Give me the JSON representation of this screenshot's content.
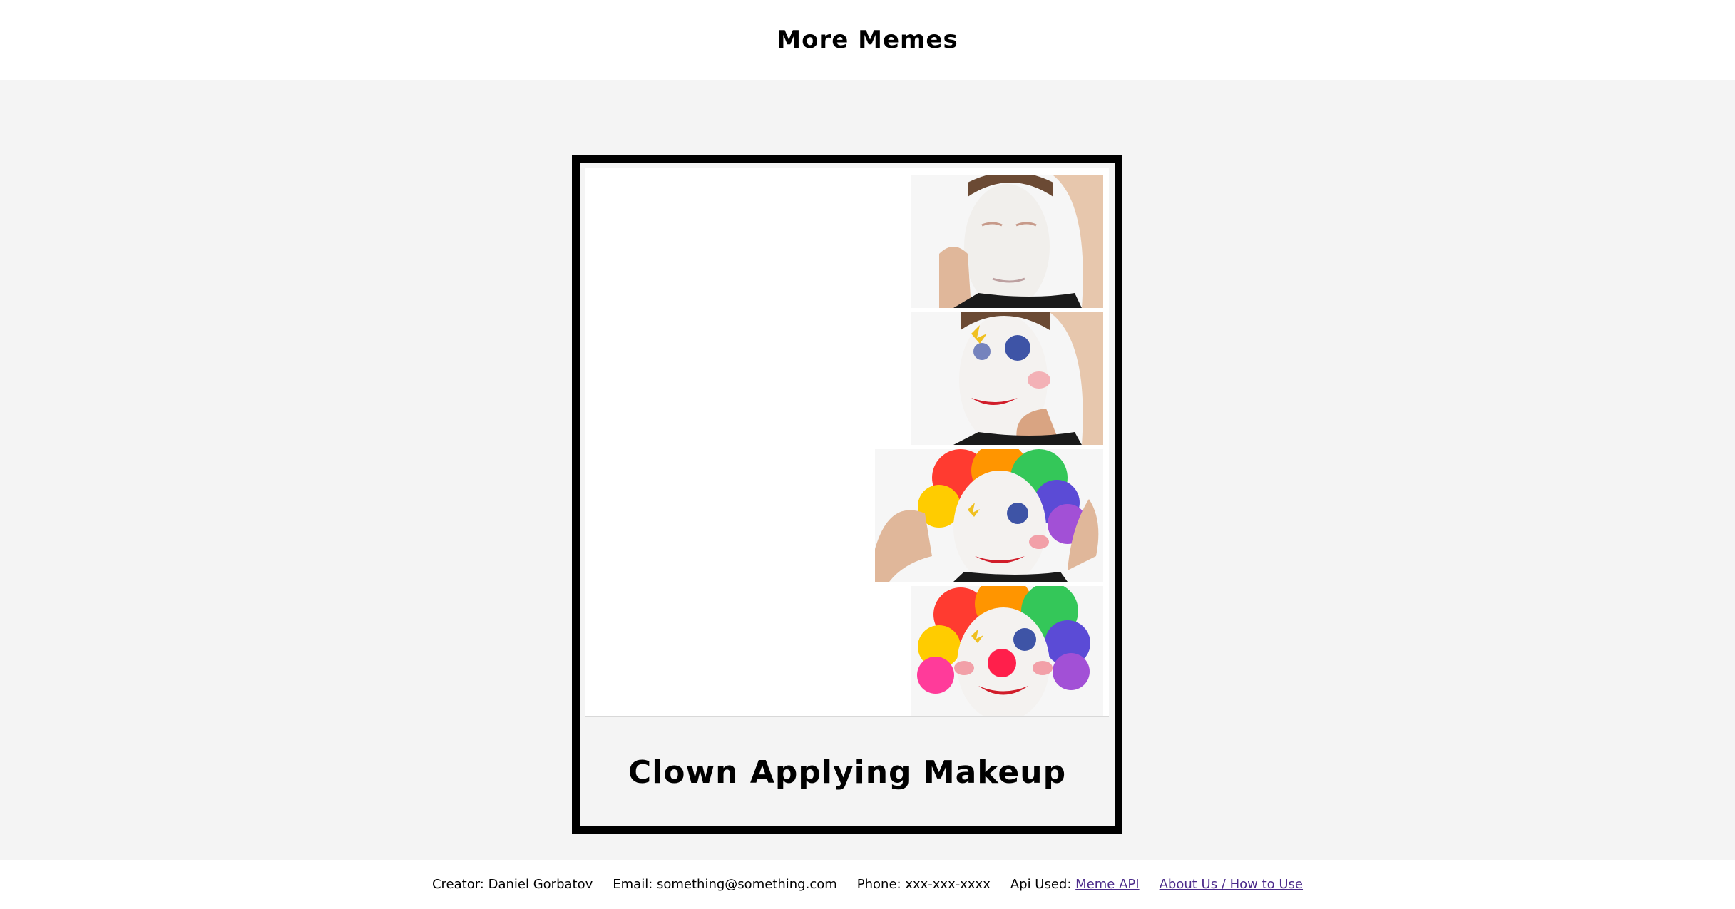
{
  "header": {
    "title": "More Memes"
  },
  "meme": {
    "name": "Clown Applying Makeup",
    "image_description_icon": "clown-makeup-meme-image"
  },
  "footer": {
    "creator_label": "Creator:",
    "creator_value": "Daniel Gorbatov",
    "email_label": "Email:",
    "email_value": "something@something.com",
    "phone_label": "Phone:",
    "phone_value": "xxx-xxx-xxxx",
    "api_label": "Api Used:",
    "api_link": "Meme API",
    "about_link": "About Us / How to Use"
  },
  "colors": {
    "page_bg": "#f4f4f4",
    "header_bg": "#ffffff",
    "card_border": "#000000",
    "link": "#4b2a8a"
  }
}
